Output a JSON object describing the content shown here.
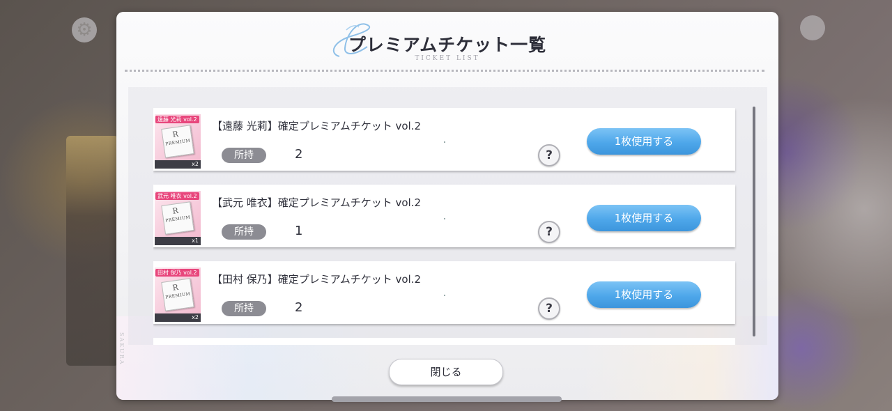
{
  "dialog": {
    "title": "プレミアムチケット一覧",
    "subtitle": "TICKET LIST",
    "side_text": "SAKURA",
    "close_label": "閉じる"
  },
  "tickets": [
    {
      "thumb_tag": "遠藤 光莉 vol.2",
      "thumb_rank": "R",
      "thumb_premium": "PREMIUM",
      "thumb_count": "x2",
      "title": "【遠藤 光莉】確定プレミアムチケット vol.2",
      "owned_label": "所持",
      "owned_count": "2",
      "help_icon": "?",
      "use_label": "1枚使用する"
    },
    {
      "thumb_tag": "武元 唯衣 vol.2",
      "thumb_rank": "R",
      "thumb_premium": "PREMIUM",
      "thumb_count": "x1",
      "title": "【武元 唯衣】確定プレミアムチケット vol.2",
      "owned_label": "所持",
      "owned_count": "1",
      "help_icon": "?",
      "use_label": "1枚使用する"
    },
    {
      "thumb_tag": "田村 保乃 vol.2",
      "thumb_rank": "R",
      "thumb_premium": "PREMIUM",
      "thumb_count": "x2",
      "title": "【田村 保乃】確定プレミアムチケット vol.2",
      "owned_label": "所持",
      "owned_count": "2",
      "help_icon": "?",
      "use_label": "1枚使用する"
    }
  ],
  "colors": {
    "accent_blue": "#4ea7ea",
    "tag_pink": "#e8467c",
    "badge_gray": "#8c8c93"
  }
}
